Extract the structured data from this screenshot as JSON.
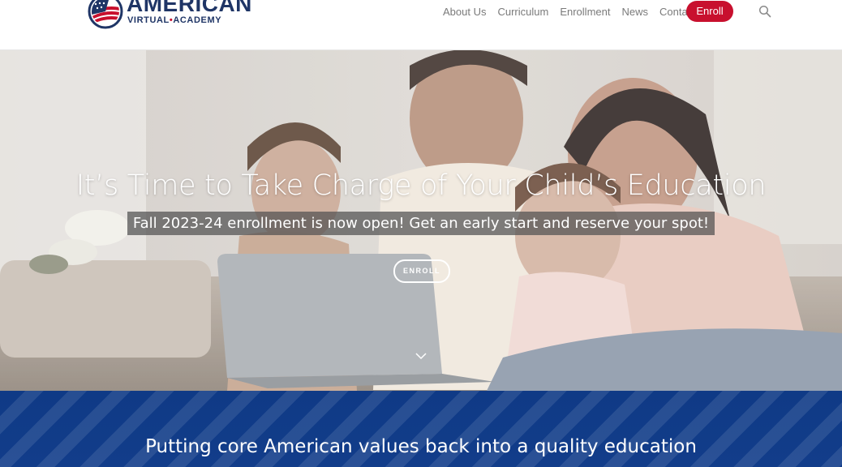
{
  "brand": {
    "name_line1": "AMERICAN",
    "name_line2_a": "VIRTUAL",
    "name_line2_sep": "•",
    "name_line2_b": "ACADEMY",
    "colors": {
      "navy": "#1f3566",
      "red": "#c8102e"
    }
  },
  "nav": {
    "items": [
      {
        "label": "About Us"
      },
      {
        "label": "Curriculum"
      },
      {
        "label": "Enrollment"
      },
      {
        "label": "News"
      },
      {
        "label": "Contact"
      }
    ],
    "enroll_label": "Enroll",
    "search_icon": "search-icon"
  },
  "hero": {
    "title": "It’s Time to Take Charge of Your Child’s Education",
    "subtitle": "Fall 2023-24 enrollment is now open! Get an early start and reserve your spot!",
    "cta_label": "ENROLL",
    "scroll_icon": "chevron-down-icon"
  },
  "band": {
    "text": "Putting core American values back into a quality education",
    "color": "#0f3a86"
  }
}
